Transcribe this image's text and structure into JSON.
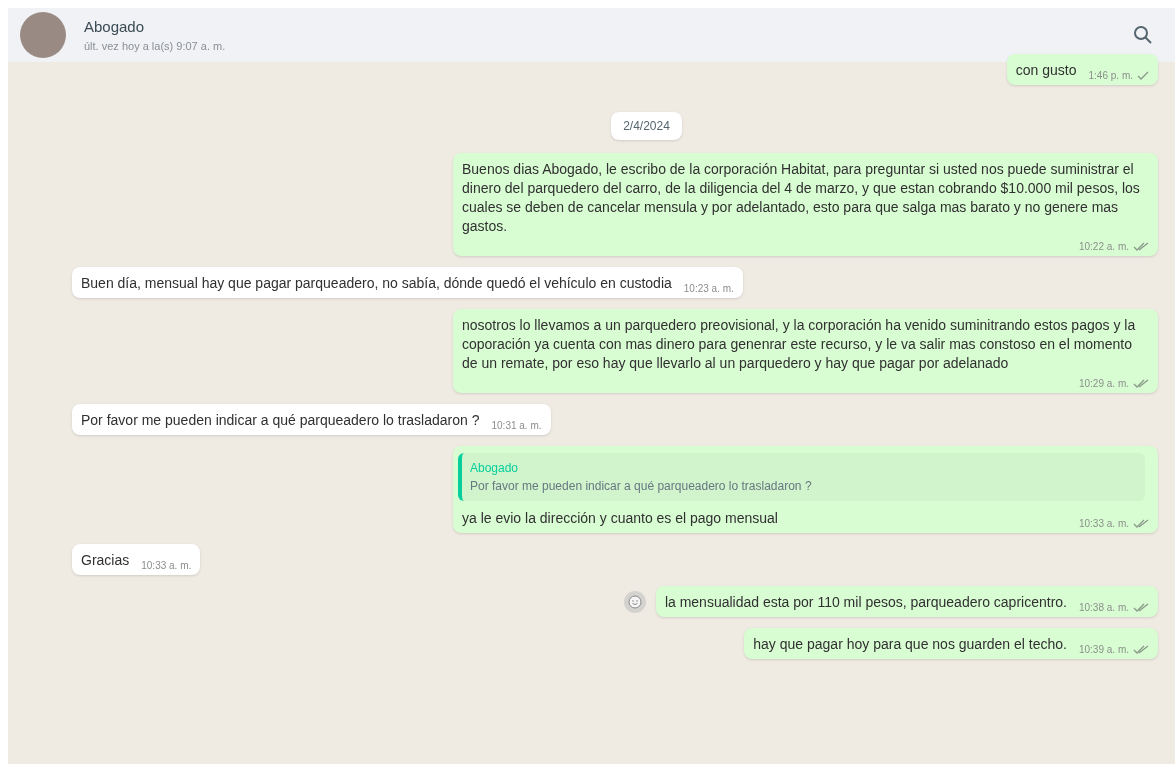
{
  "header": {
    "contact_name": "Abogado",
    "last_seen": "últ. vez hoy a la(s) 9:07 a. m."
  },
  "messages": [
    {
      "kind": "outgoing",
      "text": "con gusto",
      "time": "1:46 p. m.",
      "double_check": false
    },
    {
      "kind": "date",
      "text": "2/4/2024"
    },
    {
      "kind": "outgoing",
      "text": "Buenos dias Abogado, le escribo de la corporación Habitat, para preguntar si usted nos puede suministrar el dinero del parquedero del carro, de la diligencia del 4 de marzo, y que estan cobrando $10.000 mil pesos, los cuales se deben de cancelar mensula y por adelantado, esto para que salga mas barato y no genere mas gastos.",
      "time": "10:22 a. m.",
      "double_check": true
    },
    {
      "kind": "incoming",
      "text": "Buen día, mensual hay que pagar parqueadero, no sabía, dónde quedó el vehículo en custodia",
      "time": "10:23 a. m."
    },
    {
      "kind": "outgoing",
      "text": "nosotros lo llevamos a un parquedero preovisional,  y la corporación ha venido suminitrando estos pagos y la coporación ya cuenta con mas dinero para genenrar este recurso, y le va salir mas constoso en el momento de un remate, por eso hay que llevarlo al un parquedero y hay que pagar por adelanado",
      "time": "10:29 a. m.",
      "double_check": true
    },
    {
      "kind": "incoming",
      "text": "Por favor me pueden indicar a qué parqueadero lo trasladaron ?",
      "time": "10:31 a. m."
    },
    {
      "kind": "outgoing",
      "quote": {
        "author": "Abogado",
        "text": "Por favor me pueden indicar a qué parqueadero lo trasladaron ?"
      },
      "text": "ya le evio la dirección y cuanto es el pago mensual",
      "time": "10:33 a. m.",
      "double_check": true
    },
    {
      "kind": "incoming",
      "text": "Gracias",
      "time": "10:33 a. m."
    },
    {
      "kind": "outgoing",
      "text": "la mensualidad esta por 110 mil pesos, parqueadero capricentro.",
      "time": "10:38 a. m.",
      "double_check": true,
      "reaction_button": true
    },
    {
      "kind": "outgoing",
      "text": "hay que pagar hoy para que nos guarden el techo.",
      "time": "10:39 a. m.",
      "double_check": true
    }
  ]
}
